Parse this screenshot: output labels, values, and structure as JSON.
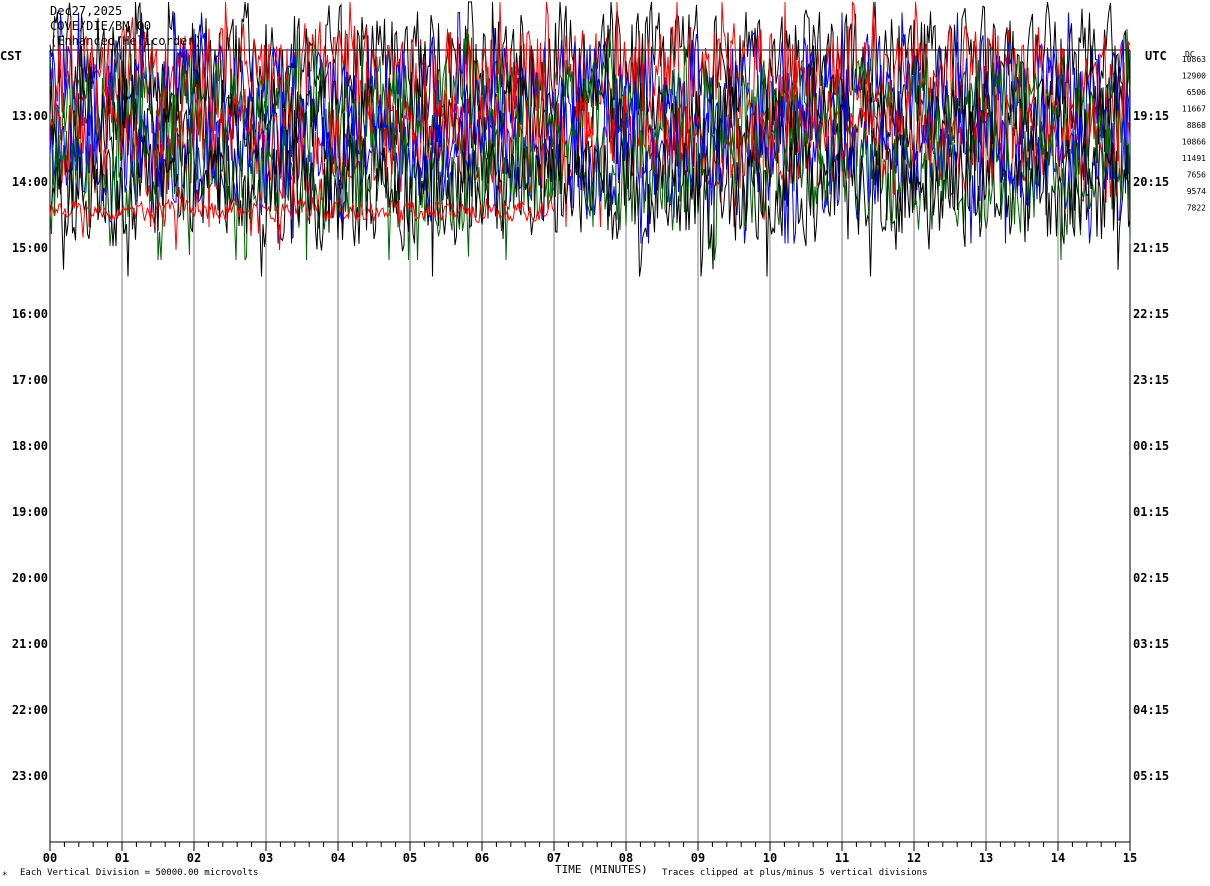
{
  "header": {
    "date": "Dec27,2025",
    "line2": "COVE/DIE/BM 00",
    "line3": "(Enhanced/Helicorder)"
  },
  "left_tz": "CST",
  "right_tz": "UTC",
  "dc_label": "DC",
  "dc_values": [
    "10863",
    "12900",
    "6506",
    "11667",
    "8868",
    "10866",
    "11491",
    "7656",
    "9574",
    "7822"
  ],
  "footer": {
    "scale_note": "Each Vertical Division = 50000.00 microvolts",
    "clip_note": "Traces clipped at plus/minus 5 vertical divisions",
    "corner_mark": "*"
  },
  "colors": {
    "trace_cycle": [
      "#000000",
      "#ff0000",
      "#0000ff",
      "#006400"
    ],
    "grid": "#808080",
    "axis": "#000000"
  },
  "chart_data": {
    "type": "line",
    "xlabel": "TIME (MINUTES)",
    "x_ticks": [
      "00",
      "01",
      "02",
      "03",
      "04",
      "05",
      "06",
      "07",
      "08",
      "09",
      "10",
      "11",
      "12",
      "13",
      "14",
      "15"
    ],
    "xlim": [
      0,
      15
    ],
    "left_row_labels": [
      "13:00",
      "14:00",
      "15:00",
      "16:00",
      "17:00",
      "18:00",
      "19:00",
      "20:00",
      "21:00",
      "22:00",
      "23:00"
    ],
    "right_row_labels": [
      "19:15",
      "20:15",
      "21:15",
      "22:15",
      "23:15",
      "00:15",
      "01:15",
      "02:15",
      "03:15",
      "04:15",
      "05:15"
    ],
    "grid": true,
    "trace_clip_divisions": 5,
    "traces": [
      {
        "row_time": "12:00",
        "color": "#000000",
        "amplitude_divisions": 5
      },
      {
        "row_time": "12:15",
        "color": "#ff0000",
        "amplitude_divisions": 5
      },
      {
        "row_time": "12:30",
        "color": "#0000ff",
        "amplitude_divisions": 5
      },
      {
        "row_time": "12:45",
        "color": "#006400",
        "amplitude_divisions": 5
      },
      {
        "row_time": "13:00",
        "color": "#000000",
        "amplitude_divisions": 5
      },
      {
        "row_time": "13:15",
        "color": "#ff0000",
        "amplitude_divisions": 5
      },
      {
        "row_time": "13:30",
        "color": "#0000ff",
        "amplitude_divisions": 5
      },
      {
        "row_time": "13:45",
        "color": "#006400",
        "amplitude_divisions": 5
      },
      {
        "row_time": "14:00",
        "color": "#000000",
        "amplitude_divisions": 5
      },
      {
        "row_time": "14:15",
        "color": "#ff0000",
        "amplitude_divisions": 1,
        "end_minute": 7
      }
    ]
  }
}
